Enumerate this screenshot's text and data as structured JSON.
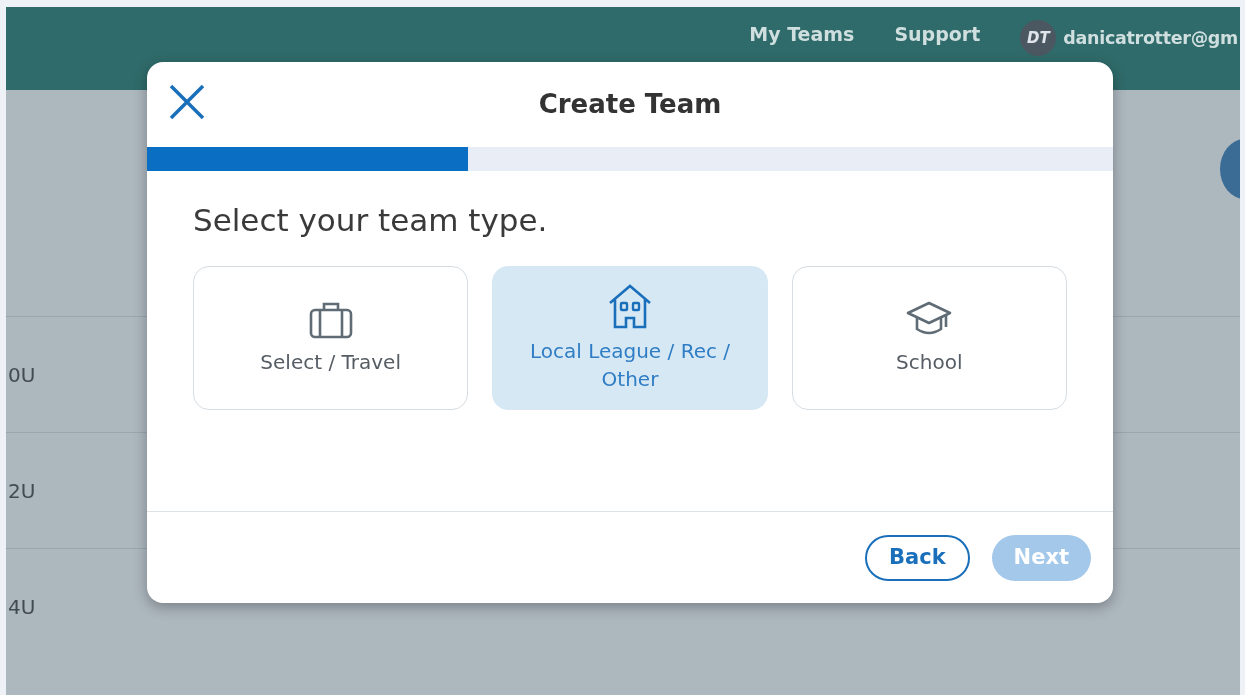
{
  "nav": {
    "links": [
      "My Teams",
      "Support"
    ],
    "user": {
      "initials": "DT",
      "email": "danicatrotter@gm"
    }
  },
  "background_rows": [
    "0U",
    "2U",
    "4U"
  ],
  "dialog": {
    "title": "Create Team",
    "progress": {
      "level": 0.332
    },
    "heading": "Select your team type.",
    "options": [
      {
        "label": "Select / Travel",
        "selected": false
      },
      {
        "label": "Local League / Rec / Other",
        "selected": true
      },
      {
        "label": "School",
        "selected": false
      }
    ],
    "buttons": [
      {
        "label": "Back",
        "disabled": false,
        "kind": "outline"
      },
      {
        "label": "Next",
        "disabled": true,
        "kind": "primary"
      }
    ]
  }
}
